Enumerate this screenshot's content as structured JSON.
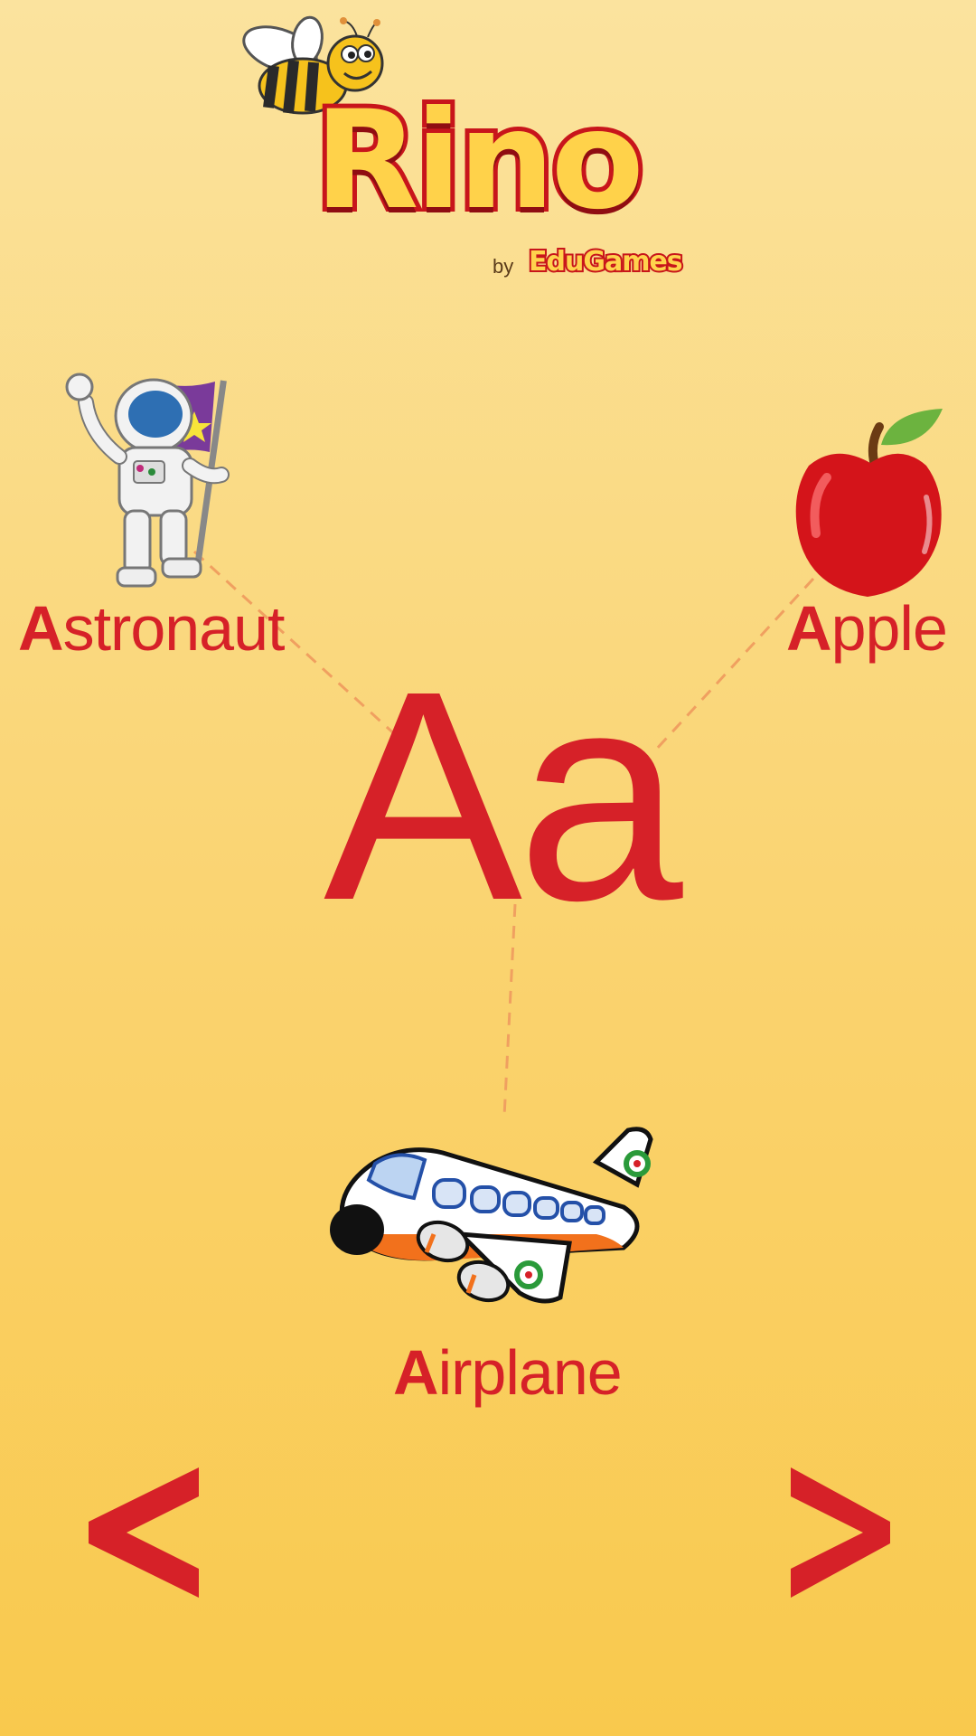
{
  "app": {
    "brand": "Rino",
    "byline": "by",
    "publisher": "EduGames"
  },
  "letter": {
    "display": "Aa"
  },
  "words": [
    {
      "first": "A",
      "rest": "stronaut",
      "icon": "astronaut-icon"
    },
    {
      "first": "A",
      "rest": "pple",
      "icon": "apple-icon"
    },
    {
      "first": "A",
      "rest": "irplane",
      "icon": "airplane-icon"
    }
  ],
  "nav": {
    "prev_label": "<",
    "next_label": ">"
  },
  "colors": {
    "accent": "#d62128",
    "background_top": "#fbe39e",
    "background_bottom": "#f9c94d",
    "connector": "#f0a060"
  }
}
